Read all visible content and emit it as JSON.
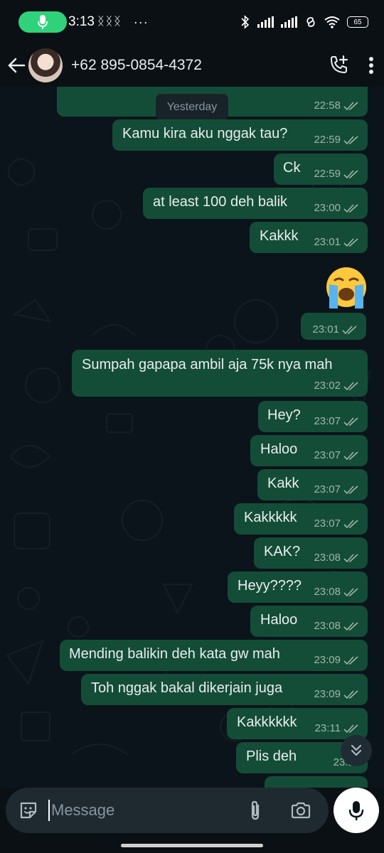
{
  "status_bar": {
    "time": "3:13",
    "notification_glyphs": "ᛝᛝᛝ",
    "more": "···",
    "battery": "65"
  },
  "header": {
    "contact": "+62 895-0854-4372"
  },
  "chat": {
    "date_label": "Yesterday",
    "messages": [
      {
        "text": "",
        "time": "22:58"
      },
      {
        "text": "Kamu kira aku nggak tau?",
        "time": "22:59"
      },
      {
        "text": "Ck",
        "time": "22:59"
      },
      {
        "text": "at least 100 deh balik",
        "time": "23:00"
      },
      {
        "text": "Kakkk",
        "time": "23:01"
      },
      {
        "text": "😭",
        "time": "23:01"
      },
      {
        "text": "Sumpah gapapa ambil aja 75k nya mah",
        "time": "23:02"
      },
      {
        "text": "Hey?",
        "time": "23:07"
      },
      {
        "text": "Haloo",
        "time": "23:07"
      },
      {
        "text": "Kakk",
        "time": "23:07"
      },
      {
        "text": "Kakkkkk",
        "time": "23:07"
      },
      {
        "text": "KAK?",
        "time": "23:08"
      },
      {
        "text": "Heyy????",
        "time": "23:08"
      },
      {
        "text": "Haloo",
        "time": "23:08"
      },
      {
        "text": "Mending balikin deh kata gw mah",
        "time": "23:09"
      },
      {
        "text": "Toh nggak bakal dikerjain juga",
        "time": "23:09"
      },
      {
        "text": "Kakkkkkk",
        "time": "23:11"
      },
      {
        "text": "Plis deh",
        "time": "23:11"
      }
    ]
  },
  "input": {
    "placeholder": "Message"
  },
  "colors": {
    "outgoing_bubble": "#144d37",
    "background": "#0b141a",
    "accent": "#2fd27a"
  },
  "icons": [
    "microphone-icon",
    "bluetooth-icon",
    "wifi-icon",
    "back-arrow-icon",
    "add-call-icon",
    "more-vert-icon",
    "sticker-icon",
    "attach-icon",
    "camera-icon",
    "chevrons-down-icon"
  ]
}
